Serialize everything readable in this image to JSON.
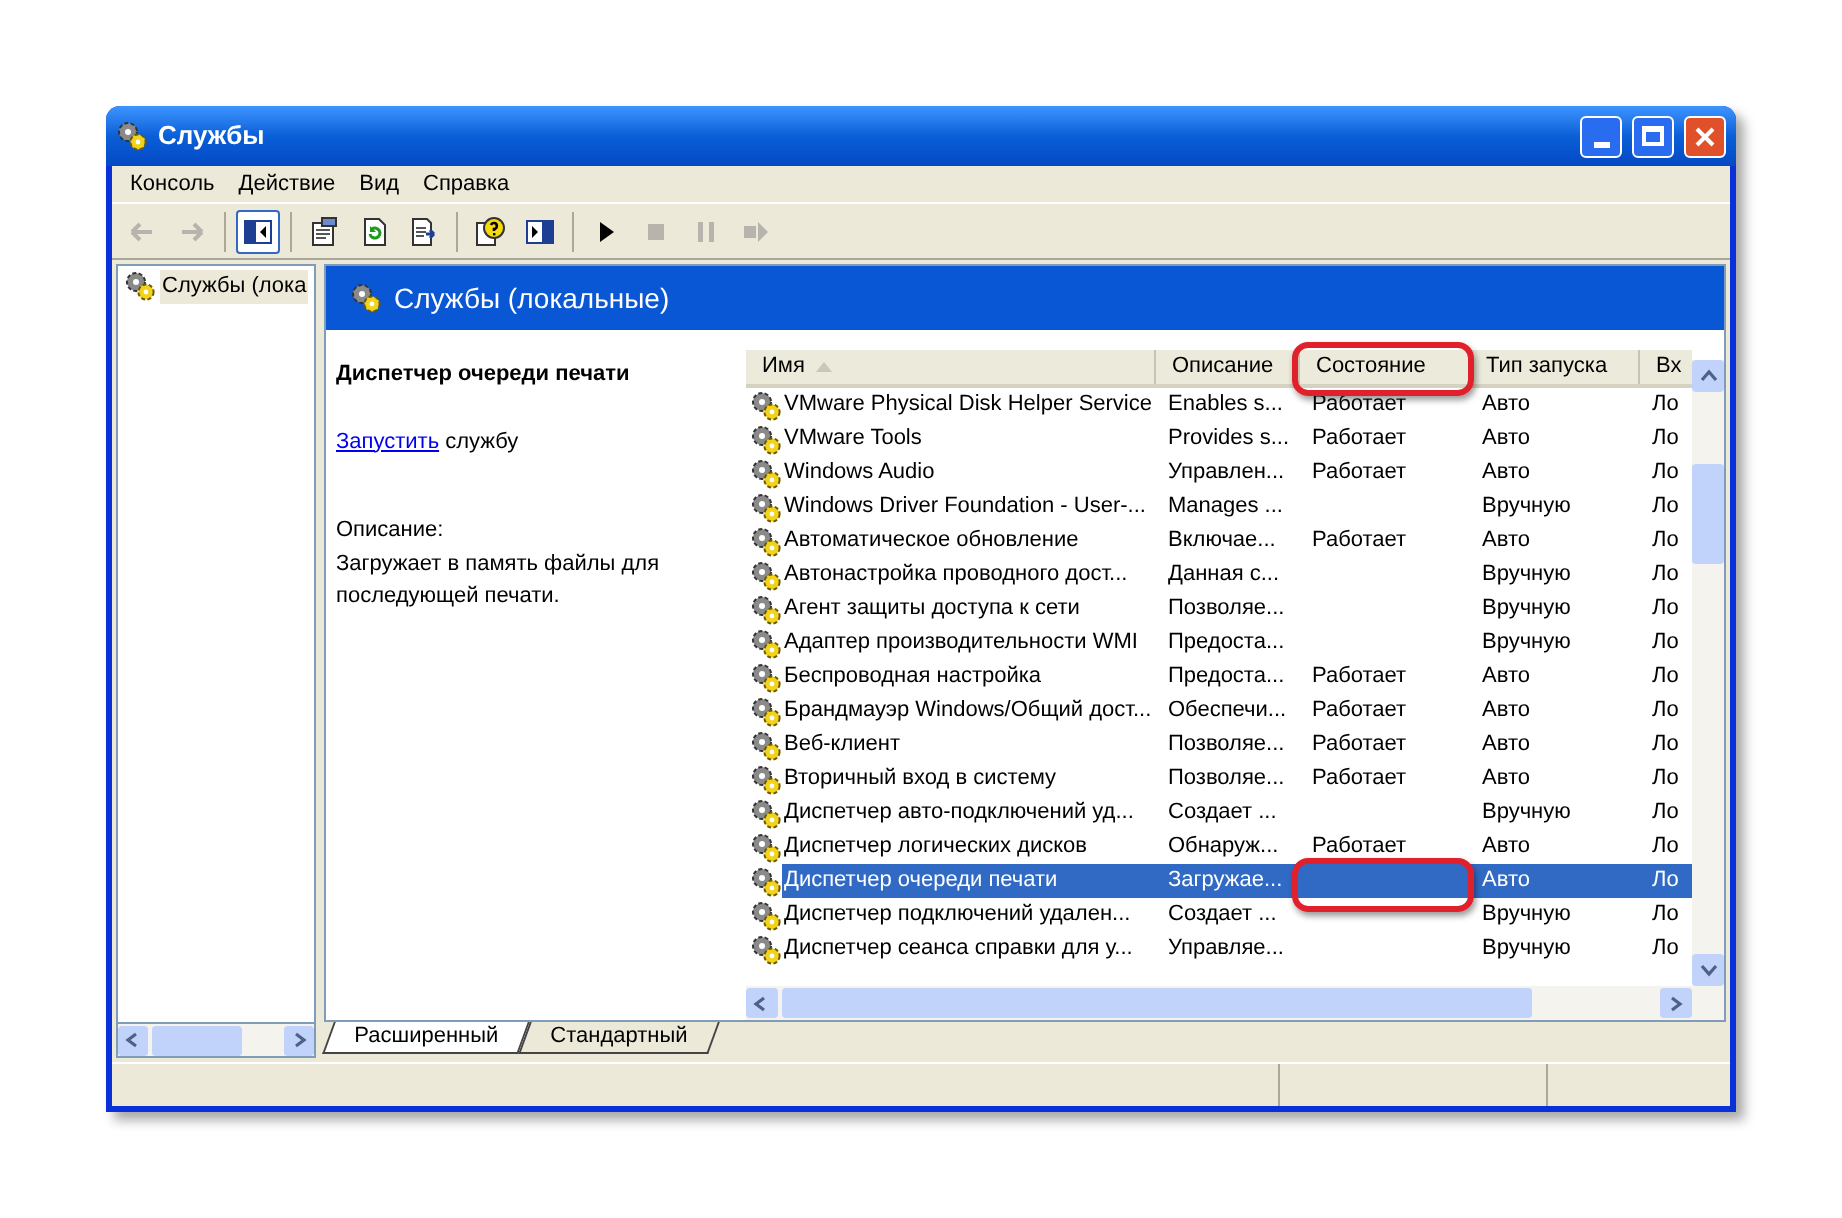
{
  "window": {
    "title": "Службы"
  },
  "menu": [
    "Консоль",
    "Действие",
    "Вид",
    "Справка"
  ],
  "toolbar": [
    {
      "kind": "back",
      "disabled": true,
      "pressed": false
    },
    {
      "kind": "forward",
      "disabled": true,
      "pressed": false
    },
    {
      "kind": "sep"
    },
    {
      "kind": "tree",
      "disabled": false,
      "pressed": true
    },
    {
      "kind": "sep"
    },
    {
      "kind": "properties",
      "disabled": false,
      "pressed": false
    },
    {
      "kind": "refresh",
      "disabled": false,
      "pressed": false
    },
    {
      "kind": "export",
      "disabled": false,
      "pressed": false
    },
    {
      "kind": "sep"
    },
    {
      "kind": "help",
      "disabled": false,
      "pressed": false
    },
    {
      "kind": "pane",
      "disabled": false,
      "pressed": false
    },
    {
      "kind": "sep"
    },
    {
      "kind": "play",
      "disabled": false,
      "pressed": false
    },
    {
      "kind": "stop",
      "disabled": true,
      "pressed": false
    },
    {
      "kind": "pause",
      "disabled": true,
      "pressed": false
    },
    {
      "kind": "restart",
      "disabled": true,
      "pressed": false
    }
  ],
  "tree": [
    {
      "label": "Службы (лока",
      "selected": true
    }
  ],
  "pane_title": "Службы (локальные)",
  "details": {
    "title": "Диспетчер очереди печати",
    "action_link": "Запустить",
    "action_text": " службу",
    "description_label": "Описание:",
    "description": "Загружает в память файлы для последующей печати."
  },
  "columns": [
    {
      "label": "Имя",
      "sorted": true,
      "highlighted": false
    },
    {
      "label": "Описание",
      "sorted": false,
      "highlighted": false
    },
    {
      "label": "Состояние",
      "sorted": false,
      "highlighted": true
    },
    {
      "label": "Тип запуска",
      "sorted": false,
      "highlighted": false
    },
    {
      "label": "Вх",
      "sorted": false,
      "highlighted": false
    }
  ],
  "rows": [
    {
      "cells": [
        "VMware Physical Disk Helper Service",
        "Enables s...",
        "Работает",
        "Авто",
        "Ло"
      ],
      "selected": false,
      "state_highlighted": false
    },
    {
      "cells": [
        "VMware Tools",
        "Provides s...",
        "Работает",
        "Авто",
        "Ло"
      ],
      "selected": false,
      "state_highlighted": false
    },
    {
      "cells": [
        "Windows Audio",
        "Управлен...",
        "Работает",
        "Авто",
        "Ло"
      ],
      "selected": false,
      "state_highlighted": false
    },
    {
      "cells": [
        "Windows Driver Foundation - User-...",
        "Manages ...",
        "",
        "Вручную",
        "Ло"
      ],
      "selected": false,
      "state_highlighted": false
    },
    {
      "cells": [
        "Автоматическое обновление",
        "Включае...",
        "Работает",
        "Авто",
        "Ло"
      ],
      "selected": false,
      "state_highlighted": false
    },
    {
      "cells": [
        "Автонастройка проводного дост...",
        "Данная с...",
        "",
        "Вручную",
        "Ло"
      ],
      "selected": false,
      "state_highlighted": false
    },
    {
      "cells": [
        "Агент защиты доступа к сети",
        "Позволяе...",
        "",
        "Вручную",
        "Ло"
      ],
      "selected": false,
      "state_highlighted": false
    },
    {
      "cells": [
        "Адаптер производительности WMI",
        "Предоста...",
        "",
        "Вручную",
        "Ло"
      ],
      "selected": false,
      "state_highlighted": false
    },
    {
      "cells": [
        "Беспроводная настройка",
        "Предоста...",
        "Работает",
        "Авто",
        "Ло"
      ],
      "selected": false,
      "state_highlighted": false
    },
    {
      "cells": [
        "Брандмауэр Windows/Общий дост...",
        "Обеспечи...",
        "Работает",
        "Авто",
        "Ло"
      ],
      "selected": false,
      "state_highlighted": false
    },
    {
      "cells": [
        "Веб-клиент",
        "Позволяе...",
        "Работает",
        "Авто",
        "Ло"
      ],
      "selected": false,
      "state_highlighted": false
    },
    {
      "cells": [
        "Вторичный вход в систему",
        "Позволяе...",
        "Работает",
        "Авто",
        "Ло"
      ],
      "selected": false,
      "state_highlighted": false
    },
    {
      "cells": [
        "Диспетчер авто-подключений уд...",
        "Создает ...",
        "",
        "Вручную",
        "Ло"
      ],
      "selected": false,
      "state_highlighted": false
    },
    {
      "cells": [
        "Диспетчер логических дисков",
        "Обнаруж...",
        "Работает",
        "Авто",
        "Ло"
      ],
      "selected": false,
      "state_highlighted": false
    },
    {
      "cells": [
        "Диспетчер очереди печати",
        "Загружае...",
        "",
        "Авто",
        "Ло"
      ],
      "selected": true,
      "state_highlighted": true
    },
    {
      "cells": [
        "Диспетчер подключений удален...",
        "Создает ...",
        "",
        "Вручную",
        "Ло"
      ],
      "selected": false,
      "state_highlighted": false
    },
    {
      "cells": [
        "Диспетчер сеанса справки для у...",
        "Управляе...",
        "",
        "Вручную",
        "Ло"
      ],
      "selected": false,
      "state_highlighted": false
    }
  ],
  "tabs": [
    {
      "label": "Расширенный",
      "selected": true
    },
    {
      "label": "Стандартный",
      "selected": false
    }
  ]
}
